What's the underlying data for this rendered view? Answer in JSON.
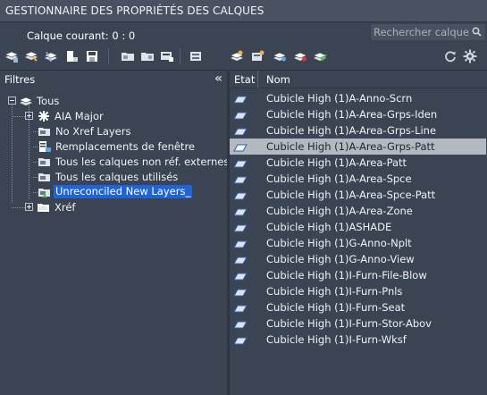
{
  "window": {
    "title": "GESTIONNAIRE DES PROPRIÉTÉS DES CALQUES"
  },
  "current_layer": "Calque courant: 0 : 0",
  "search": {
    "placeholder": "Rechercher calque",
    "icon": "search-icon"
  },
  "toolbar": {
    "left_icons": [
      "new-properties-filter-icon",
      "new-group-filter-icon",
      "layer-states-icon",
      "layer-isolate-icon",
      "save-icon",
      "filter-1-icon",
      "filter-2-icon",
      "filter-3-icon",
      "walk-icon"
    ],
    "right_icons": [
      "new-layer-icon",
      "new-layer-vp-frozen-icon",
      "delete-layer-icon",
      "set-current-icon",
      "merge-icon",
      "refresh-icon",
      "settings-icon"
    ]
  },
  "filters_panel": {
    "header": "Filtres",
    "collapse_symbol": "«",
    "tree": [
      {
        "label": "Tous",
        "level": 0,
        "icon": "layers-stack-icon",
        "expander": "minus"
      },
      {
        "label": "AIA Major",
        "level": 1,
        "icon": "star-filter-icon",
        "expander": "plus"
      },
      {
        "label": "No Xref Layers",
        "level": 1,
        "icon": "filter-folder-icon",
        "expander": ""
      },
      {
        "label": "Remplacements de fenêtre",
        "level": 1,
        "icon": "viewport-override-icon",
        "expander": ""
      },
      {
        "label": "Tous les calques non réf. externes",
        "level": 1,
        "icon": "filter-folder-icon",
        "expander": ""
      },
      {
        "label": "Tous les calques utilisés",
        "level": 1,
        "icon": "filter-folder-icon",
        "expander": ""
      },
      {
        "label": "Unreconciled New Layers_",
        "level": 1,
        "icon": "unreconciled-icon",
        "expander": "",
        "selected": true
      },
      {
        "label": "Xréf",
        "level": 1,
        "icon": "xref-folder-icon",
        "expander": "plus"
      }
    ]
  },
  "layers_panel": {
    "columns": [
      "Etat",
      "Nom"
    ],
    "rows": [
      {
        "name": "Cubicle High (1)A-Anno-Scrn"
      },
      {
        "name": "Cubicle High (1)A-Area-Grps-Iden"
      },
      {
        "name": "Cubicle High (1)A-Area-Grps-Line"
      },
      {
        "name": "Cubicle High (1)A-Area-Grps-Patt",
        "highlight": true
      },
      {
        "name": "Cubicle High (1)A-Area-Patt"
      },
      {
        "name": "Cubicle High (1)A-Area-Spce"
      },
      {
        "name": "Cubicle High (1)A-Area-Spce-Patt"
      },
      {
        "name": "Cubicle High (1)A-Area-Zone"
      },
      {
        "name": "Cubicle High (1)ASHADE"
      },
      {
        "name": "Cubicle High (1)G-Anno-Nplt"
      },
      {
        "name": "Cubicle High (1)G-Anno-View"
      },
      {
        "name": "Cubicle High (1)I-Furn-File-Blow"
      },
      {
        "name": "Cubicle High (1)I-Furn-Pnls"
      },
      {
        "name": "Cubicle High (1)I-Furn-Seat"
      },
      {
        "name": "Cubicle High (1)I-Furn-Stor-Abov"
      },
      {
        "name": "Cubicle High (1)I-Furn-Wksf"
      }
    ]
  },
  "colors": {
    "background": "#3b4453",
    "selection": "#1f63d8",
    "row_highlight": "#b4b9c1"
  }
}
